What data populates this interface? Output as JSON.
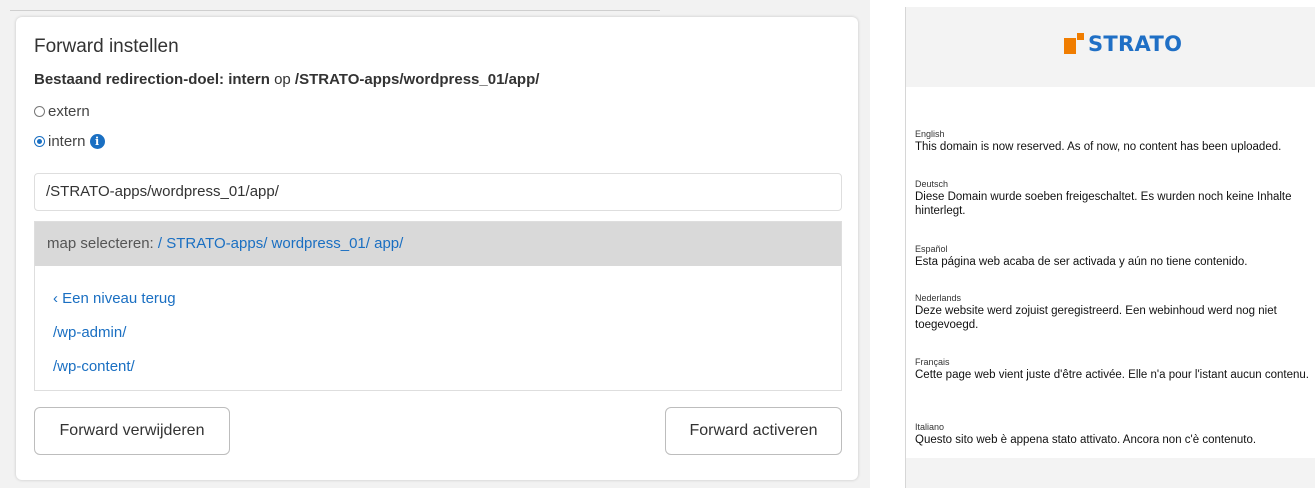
{
  "forward": {
    "title": "Forward instellen",
    "subtitle_label": "Bestaand redirection-doel:",
    "subtitle_type": "intern",
    "subtitle_op": "op",
    "subtitle_path": "/STRATO-apps/wordpress_01/app/",
    "radio_extern": "extern",
    "radio_intern": "intern",
    "selected": "intern",
    "path_value": "/STRATO-apps/wordpress_01/app/",
    "browser": {
      "label": "map selecteren:",
      "breadcrumb": "/ STRATO-apps/ wordpress_01/ app/",
      "back": "Een niveau terug",
      "back_glyph": "‹",
      "folders": [
        "/wp-admin/",
        "/wp-content/"
      ]
    },
    "btn_delete": "Forward verwijderen",
    "btn_activate": "Forward activeren"
  },
  "strato": {
    "logo_text": "STRATO",
    "brand_orange": "#f07d00",
    "brand_blue": "#1f6fc5",
    "languages": [
      {
        "name": "English",
        "text": "This domain is now reserved. As of now, no content has been uploaded."
      },
      {
        "name": "Deutsch",
        "text": "Diese Domain wurde soeben freigeschaltet. Es wurden noch keine Inhalte hinterlegt."
      },
      {
        "name": "Español",
        "text": "Esta página web acaba de ser activada y aún no tiene contenido."
      },
      {
        "name": "Nederlands",
        "text": "Deze website werd zojuist geregistreerd. Een webinhoud werd nog niet toegevoegd."
      },
      {
        "name": "Français",
        "text": "Cette page web vient juste d'être activée. Elle n'a pour l'istant aucun contenu."
      },
      {
        "name": "Italiano",
        "text": "Questo sito web è appena stato attivato. Ancora non c'è contenuto."
      }
    ]
  }
}
